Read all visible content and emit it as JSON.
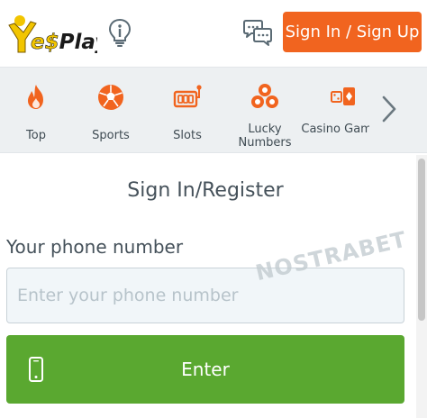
{
  "header": {
    "logo_text": "YesPlay",
    "signin_label": "Sign In / Sign Up"
  },
  "nav": {
    "items": [
      {
        "label": "Top",
        "icon": "flame-icon"
      },
      {
        "label": "Sports",
        "icon": "soccer-ball-icon"
      },
      {
        "label": "Slots",
        "icon": "slot-machine-icon"
      },
      {
        "label": "Lucky Numbers",
        "icon": "lottery-balls-icon"
      },
      {
        "label": "Casino Games",
        "icon": "casino-cards-icon"
      }
    ],
    "next_icon": "chevron-right-icon"
  },
  "form": {
    "title": "Sign In/Register",
    "phone_label": "Your phone number",
    "phone_placeholder": "Enter your phone number",
    "phone_value": "",
    "enter_label": "Enter"
  },
  "watermark": "NOSTRABET",
  "colors": {
    "accent_orange": "#f1641f",
    "enter_green": "#5aa830",
    "nav_background": "#edf0f2",
    "text": "#45515a"
  }
}
